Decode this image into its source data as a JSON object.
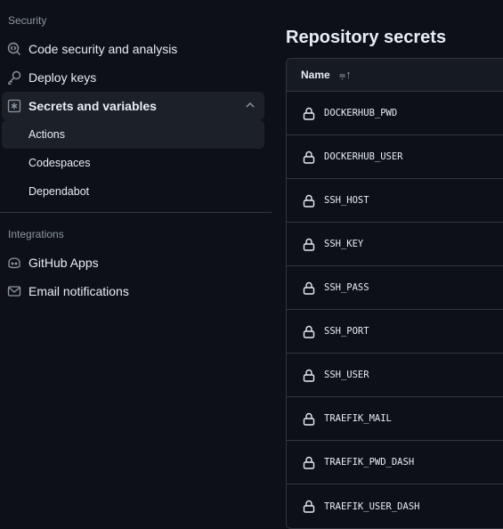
{
  "sidebar": {
    "security_heading": "Security",
    "items": [
      {
        "label": "Code security and analysis",
        "icon": "codescan-icon"
      },
      {
        "label": "Deploy keys",
        "icon": "key-icon"
      },
      {
        "label": "Secrets and variables",
        "icon": "asterisk-icon"
      }
    ],
    "subitems": [
      {
        "label": "Actions"
      },
      {
        "label": "Codespaces"
      },
      {
        "label": "Dependabot"
      }
    ],
    "integrations_heading": "Integrations",
    "integrations": [
      {
        "label": "GitHub Apps",
        "icon": "copilot-icon"
      },
      {
        "label": "Email notifications",
        "icon": "mail-icon"
      }
    ]
  },
  "main": {
    "title": "Repository secrets",
    "column_name": "Name",
    "secrets": [
      "DOCKERHUB_PWD",
      "DOCKERHUB_USER",
      "SSH_HOST",
      "SSH_KEY",
      "SSH_PASS",
      "SSH_PORT",
      "SSH_USER",
      "TRAEFIK_MAIL",
      "TRAEFIK_PWD_DASH",
      "TRAEFIK_USER_DASH"
    ]
  }
}
